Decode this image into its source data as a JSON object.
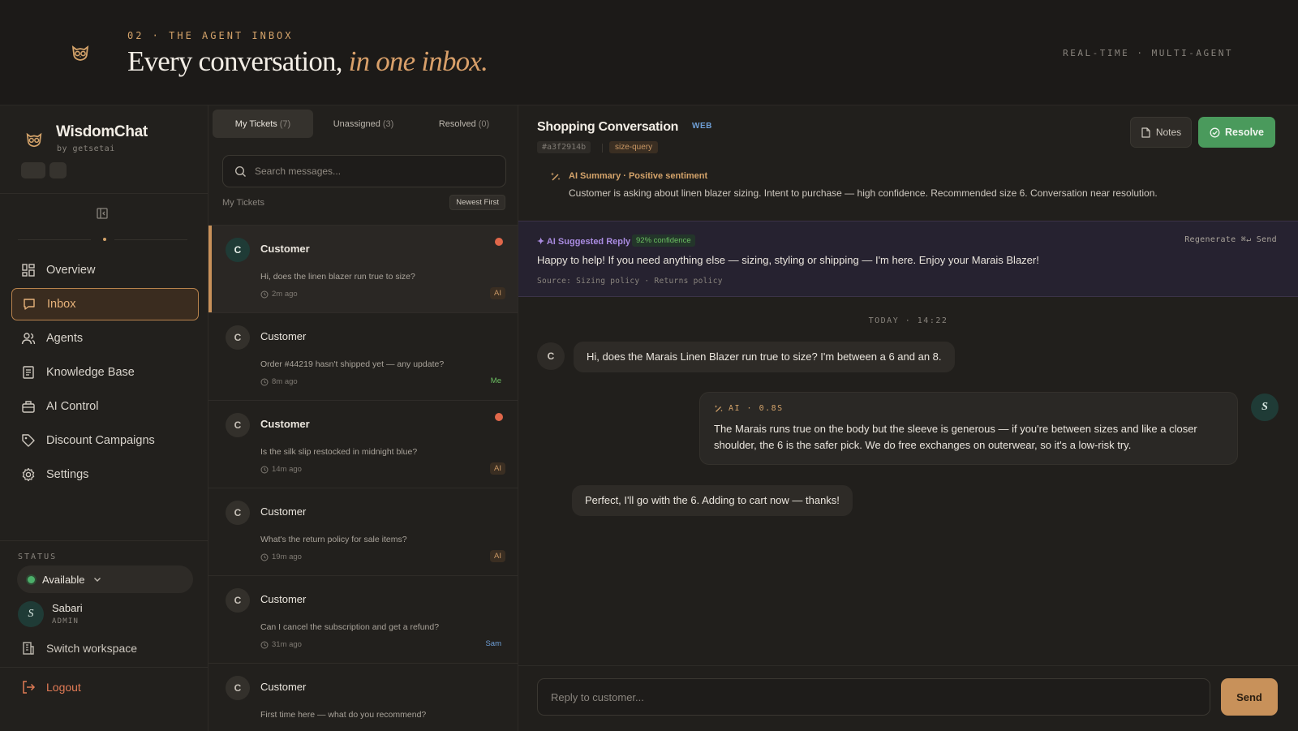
{
  "hero": {
    "kicker": "02 · THE AGENT INBOX",
    "title_main": "Every conversation,",
    "title_accent": "in one inbox.",
    "right_label": "REAL-TIME · MULTI-AGENT",
    "logo_icon": "owl-icon"
  },
  "brand": {
    "name": "WisdomChat",
    "by": "by getsetai"
  },
  "nav": {
    "items": [
      {
        "label": "Overview",
        "icon": "grid-icon"
      },
      {
        "label": "Inbox",
        "icon": "chat-icon",
        "active": true
      },
      {
        "label": "Agents",
        "icon": "users-icon"
      },
      {
        "label": "Knowledge Base",
        "icon": "book-icon"
      },
      {
        "label": "AI Control",
        "icon": "bot-icon"
      },
      {
        "label": "Discount Campaigns",
        "icon": "tag-icon"
      },
      {
        "label": "Settings",
        "icon": "gear-icon"
      }
    ]
  },
  "status": {
    "label": "STATUS",
    "value": "Available"
  },
  "user": {
    "initial": "S",
    "name": "Sabari",
    "role": "ADMIN"
  },
  "footer": {
    "switch_workspace": "Switch workspace",
    "logout": "Logout"
  },
  "tickets": {
    "tabs": [
      {
        "label": "My Tickets",
        "count": "(7)",
        "active": true
      },
      {
        "label": "Unassigned",
        "count": "(3)"
      },
      {
        "label": "Resolved",
        "count": "(0)"
      }
    ],
    "search_placeholder": "Search messages...",
    "list_label": "My Tickets",
    "sort_label": "Newest First",
    "items": [
      {
        "initial": "C",
        "name": "Customer",
        "message": "Hi, does the linen blazer run true to size?",
        "time": "2m ago",
        "badge": "AI",
        "unread": true,
        "active": true
      },
      {
        "initial": "C",
        "name": "Customer",
        "message": "Order #44219 hasn't shipped yet — any update?",
        "time": "8m ago",
        "badge": "Me",
        "unread": false
      },
      {
        "initial": "C",
        "name": "Customer",
        "message": "Is the silk slip restocked in midnight blue?",
        "time": "14m ago",
        "badge": "AI",
        "unread": true
      },
      {
        "initial": "C",
        "name": "Customer",
        "message": "What's the return policy for sale items?",
        "time": "19m ago",
        "badge": "AI",
        "unread": false
      },
      {
        "initial": "C",
        "name": "Customer",
        "message": "Can I cancel the subscription and get a refund?",
        "time": "31m ago",
        "badge": "Sam",
        "unread": false
      },
      {
        "initial": "C",
        "name": "Customer",
        "message": "First time here — what do you recommend?",
        "time": "",
        "badge": "",
        "unread": false
      }
    ]
  },
  "conversation": {
    "title": "Shopping Conversation",
    "channel": "WEB",
    "id": "#a3f2914b",
    "tag": "size-query",
    "notes_label": "Notes",
    "resolve_label": "Resolve",
    "summary_title": "AI Summary · Positive sentiment",
    "summary_text": "Customer is asking about linen blazer sizing. Intent to purchase — high confidence. Recommended size 6. Conversation near resolution.",
    "suggest_title": "✦ AI Suggested Reply",
    "suggest_confidence": "92% confidence",
    "suggest_actions": "Regenerate  ⌘↵ Send",
    "suggest_text": "Happy to help! If you need anything else — sizing, styling or shipping — I'm here. Enjoy your Marais Blazer!",
    "suggest_source": "Source: Sizing policy · Returns policy",
    "date_separator": "TODAY · 14:22",
    "messages": [
      {
        "from": "customer",
        "initial": "C",
        "text": "Hi, does the Marais Linen Blazer run true to size? I'm between a 6 and an 8."
      },
      {
        "from": "agent",
        "initial": "S",
        "tag": "AI · 0.8S",
        "text": "The Marais runs true on the body but the sleeve is generous — if you're between sizes and like a closer shoulder, the 6 is the safer pick. We do free exchanges on outerwear, so it's a low-risk try."
      },
      {
        "from": "customer",
        "initial": "",
        "text": "Perfect, I'll go with the 6. Adding to cart now — thanks!"
      }
    ],
    "reply_placeholder": "Reply to customer...",
    "send_label": "Send"
  },
  "colors": {
    "accent": "#d4a36a",
    "resolve": "#4a9a5c",
    "unread_dot": "#e0674a",
    "ai_purple": "#a98be0"
  }
}
